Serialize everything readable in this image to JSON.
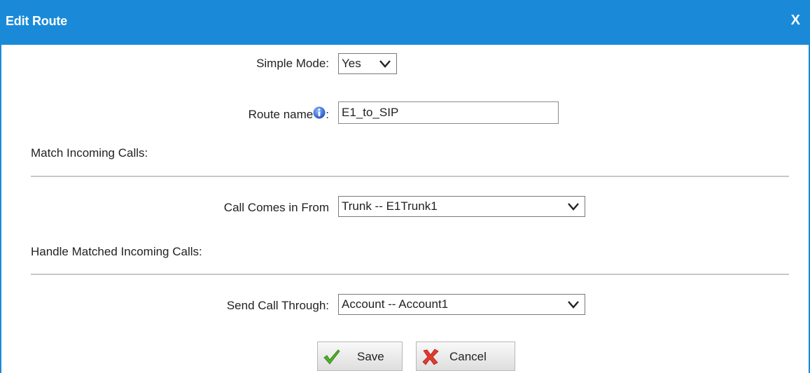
{
  "dialog": {
    "title": "Edit Route",
    "close_label": "X"
  },
  "form": {
    "simple_mode": {
      "label": "Simple Mode:",
      "value": "Yes"
    },
    "route_name": {
      "label": "Route name",
      "colon": ":",
      "value": "E1_to_SIP"
    },
    "match_section": {
      "heading": "Match Incoming Calls:"
    },
    "call_comes_in_from": {
      "label": "Call Comes in From",
      "value": "Trunk -- E1Trunk1"
    },
    "handle_section": {
      "heading": "Handle Matched Incoming Calls:"
    },
    "send_call_through": {
      "label": "Send Call Through:",
      "value": "Account -- Account1"
    }
  },
  "buttons": {
    "save_label": "Save",
    "cancel_label": "Cancel"
  },
  "colors": {
    "titlebar": "#1a8ad8",
    "info_icon": "#2f6fd6",
    "save_check": "#4caf2a",
    "cancel_x": "#e23b2e"
  },
  "icons": {
    "info": "info-icon",
    "dropdown": "chevron-down-icon",
    "save": "checkmark-icon",
    "cancel": "x-mark-icon"
  }
}
